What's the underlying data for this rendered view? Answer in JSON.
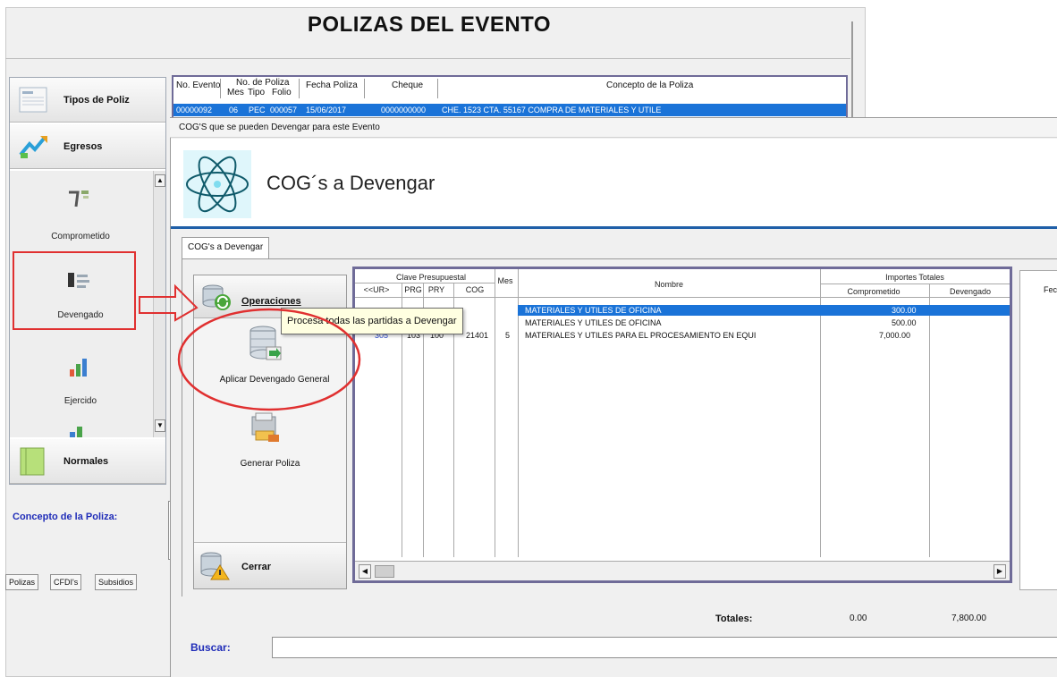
{
  "main_window": {
    "title": "POLIZAS DEL EVENTO"
  },
  "nav": {
    "groups": [
      {
        "label": "Tipos de Poliz",
        "icon": "document-list-icon"
      },
      {
        "label": "Egresos",
        "icon": "egresos-arrows-icon"
      },
      {
        "label": "Normales",
        "icon": "notebook-icon"
      }
    ],
    "items": [
      {
        "label": "Comprometido",
        "icon": "comprometido-icon"
      },
      {
        "label": "Devengado",
        "icon": "devengado-icon"
      },
      {
        "label": "Ejercido",
        "icon": "chart-icon"
      }
    ]
  },
  "concepto": {
    "label": "Concepto de la Poliza:"
  },
  "bottom_tabs": [
    "Polizas",
    "CFDI's",
    "Subsidios"
  ],
  "background_grid": {
    "headers": {
      "no_evento": "No. Evento",
      "no_poliza": "No. de Poliza",
      "mes": "Mes",
      "tipo": "Tipo",
      "folio": "Folio",
      "fecha": "Fecha Poliza",
      "cheque": "Cheque",
      "concepto": "Concepto de la Poliza"
    },
    "selected_row": {
      "no_evento": "00000092",
      "mes": "06",
      "tipo": "PEC",
      "folio": "000057",
      "fecha": "15/06/2017",
      "cheque": "0000000000",
      "concepto": "CHE. 1523 CTA. 55167 COMPRA DE MATERIALES Y UTILE"
    }
  },
  "dialog": {
    "title": "COG'S que se pueden Devengar para este Evento",
    "header_title": "COG´s a Devengar",
    "tab": "COG's a Devengar"
  },
  "operations": {
    "header": "Operaciones",
    "aplicar": "Aplicar Devengado General",
    "generar": "Generar Poliza",
    "cerrar": "Cerrar"
  },
  "tooltip": "Procesa todas las partidas a Devengar",
  "cog_grid": {
    "headers": {
      "clave": "Clave Presupuestal",
      "ur": "<<UR>",
      "prg": "PRG",
      "pry": "PRY",
      "cog": "COG",
      "mes": "Mes",
      "nombre": "Nombre",
      "importes": "Importes Totales",
      "comprometido": "Comprometido",
      "devengado": "Devengado",
      "fecha": "Fec"
    },
    "rows": [
      {
        "ur": "",
        "prg": "",
        "pry": "",
        "cog": "",
        "mes": "",
        "nombre": "MATERIALES Y UTILES DE OFICINA",
        "comprometido": "300.00",
        "devengado": "",
        "selected": true
      },
      {
        "ur": "",
        "prg": "",
        "pry": "",
        "cog": "",
        "mes": "",
        "nombre": "MATERIALES Y UTILES DE OFICINA",
        "comprometido": "500.00",
        "devengado": "",
        "selected": false
      },
      {
        "ur": "305",
        "prg": "103",
        "pry": "100",
        "cog": "21401",
        "mes": "5",
        "nombre": "MATERIALES Y UTILES PARA EL PROCESAMIENTO EN EQUI",
        "comprometido": "7,000.00",
        "devengado": "",
        "selected": false
      }
    ]
  },
  "totals": {
    "label": "Totales:",
    "comprometido": "0.00",
    "devengado": "7,800.00"
  },
  "search": {
    "label": "Buscar:",
    "value": ""
  },
  "colors": {
    "selection": "#1a73d8",
    "annotation_red": "#e03030",
    "grid_border": "#6f6b98",
    "label_blue": "#1f2cb8"
  }
}
